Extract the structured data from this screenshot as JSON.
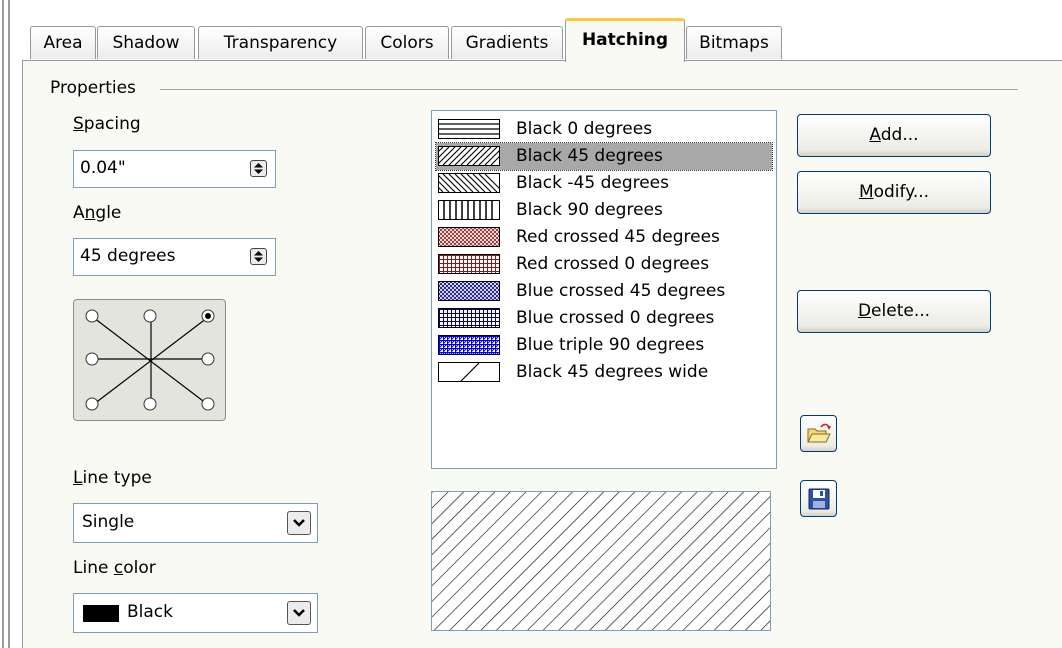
{
  "tabs": [
    {
      "label": "Area"
    },
    {
      "label": "Shadow"
    },
    {
      "label": "Transparency"
    },
    {
      "label": "Colors"
    },
    {
      "label": "Gradients"
    },
    {
      "label": "Hatching",
      "active": true
    },
    {
      "label": "Bitmaps"
    }
  ],
  "properties": {
    "legend": "Properties",
    "spacing": {
      "label_underlined": "S",
      "label_rest": "pacing",
      "value": "0.04\""
    },
    "angle": {
      "label_pre": "A",
      "label_underlined": "n",
      "label_rest": "gle",
      "value": "45 degrees",
      "selected_direction": "top-right"
    },
    "line_type": {
      "label_underlined": "L",
      "label_rest": "ine type",
      "value": "Single"
    },
    "line_color": {
      "label_pre": "Line ",
      "label_underlined": "c",
      "label_rest": "olor",
      "value": "Black",
      "swatch_color": "#000000"
    }
  },
  "hatch_list": {
    "selected_index": 1,
    "items": [
      {
        "label": "Black 0 degrees",
        "pattern": "black-0",
        "color": "#000000"
      },
      {
        "label": "Black 45 degrees",
        "pattern": "black-45",
        "color": "#000000"
      },
      {
        "label": "Black -45 degrees",
        "pattern": "black-neg45",
        "color": "#000000"
      },
      {
        "label": "Black 90 degrees",
        "pattern": "black-90",
        "color": "#000000"
      },
      {
        "label": "Red crossed 45 degrees",
        "pattern": "crossed-45",
        "color": "#8b1a1a"
      },
      {
        "label": "Red crossed 0 degrees",
        "pattern": "crossed-0",
        "color": "#8b1a1a"
      },
      {
        "label": "Blue crossed 45 degrees",
        "pattern": "crossed-45",
        "color": "#000080"
      },
      {
        "label": "Blue crossed 0 degrees",
        "pattern": "crossed-0",
        "color": "#000080"
      },
      {
        "label": "Blue triple 90 degrees",
        "pattern": "triple-90",
        "color": "#0000ff"
      },
      {
        "label": "Black 45 degrees wide",
        "pattern": "wide-45",
        "color": "#000000"
      }
    ]
  },
  "buttons": {
    "add": {
      "u": "A",
      "rest": "dd..."
    },
    "modify": {
      "u": "M",
      "rest": "odify..."
    },
    "delete": {
      "u": "D",
      "rest": "elete..."
    },
    "load_icon": "open-folder-icon",
    "save_icon": "floppy-disk-icon"
  },
  "colors": {
    "active_tab_accent": "#ffc83c",
    "panel_bg": "#fafaf5",
    "border": "#7f9db9"
  }
}
